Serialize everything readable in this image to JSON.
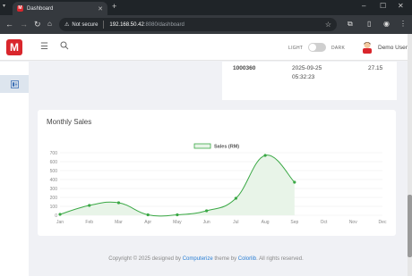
{
  "browser": {
    "tab_title": "Dashboard",
    "favicon_letter": "M",
    "omnibox_warning": "Not secure",
    "url_host": "192.168.50.42",
    "url_rest": ":8080/dashboard"
  },
  "header": {
    "logo_letter": "M",
    "light_label": "LIGHT",
    "dark_label": "DARK",
    "user_name": "Demo User"
  },
  "table_row": {
    "id": "1000360",
    "date": "2025-09-25",
    "time": "05:32:23",
    "amount": "27.15"
  },
  "chart": {
    "title": "Monthly Sales"
  },
  "chart_data": {
    "type": "line",
    "title": "Monthly Sales",
    "categories": [
      "Jan",
      "Feb",
      "Mar",
      "Apr",
      "May",
      "Jun",
      "Jul",
      "Aug",
      "Sep",
      "Oct",
      "Nov",
      "Dec"
    ],
    "series": [
      {
        "name": "Sales (RM)",
        "values": [
          10,
          110,
          140,
          5,
          5,
          50,
          190,
          670,
          370,
          null,
          null,
          null
        ],
        "color": "#3aa845"
      }
    ],
    "yticks": [
      "0",
      "100",
      "200",
      "300",
      "400",
      "500",
      "600",
      "700"
    ],
    "ylim": [
      0,
      700
    ],
    "grid": true,
    "legend": "top-center"
  },
  "footer": {
    "prefix": "Copyright © 2025 designed by ",
    "link1": "Computerize",
    "mid": " theme by ",
    "link2": "Colorlib",
    "suffix": ". All rights reserved."
  }
}
